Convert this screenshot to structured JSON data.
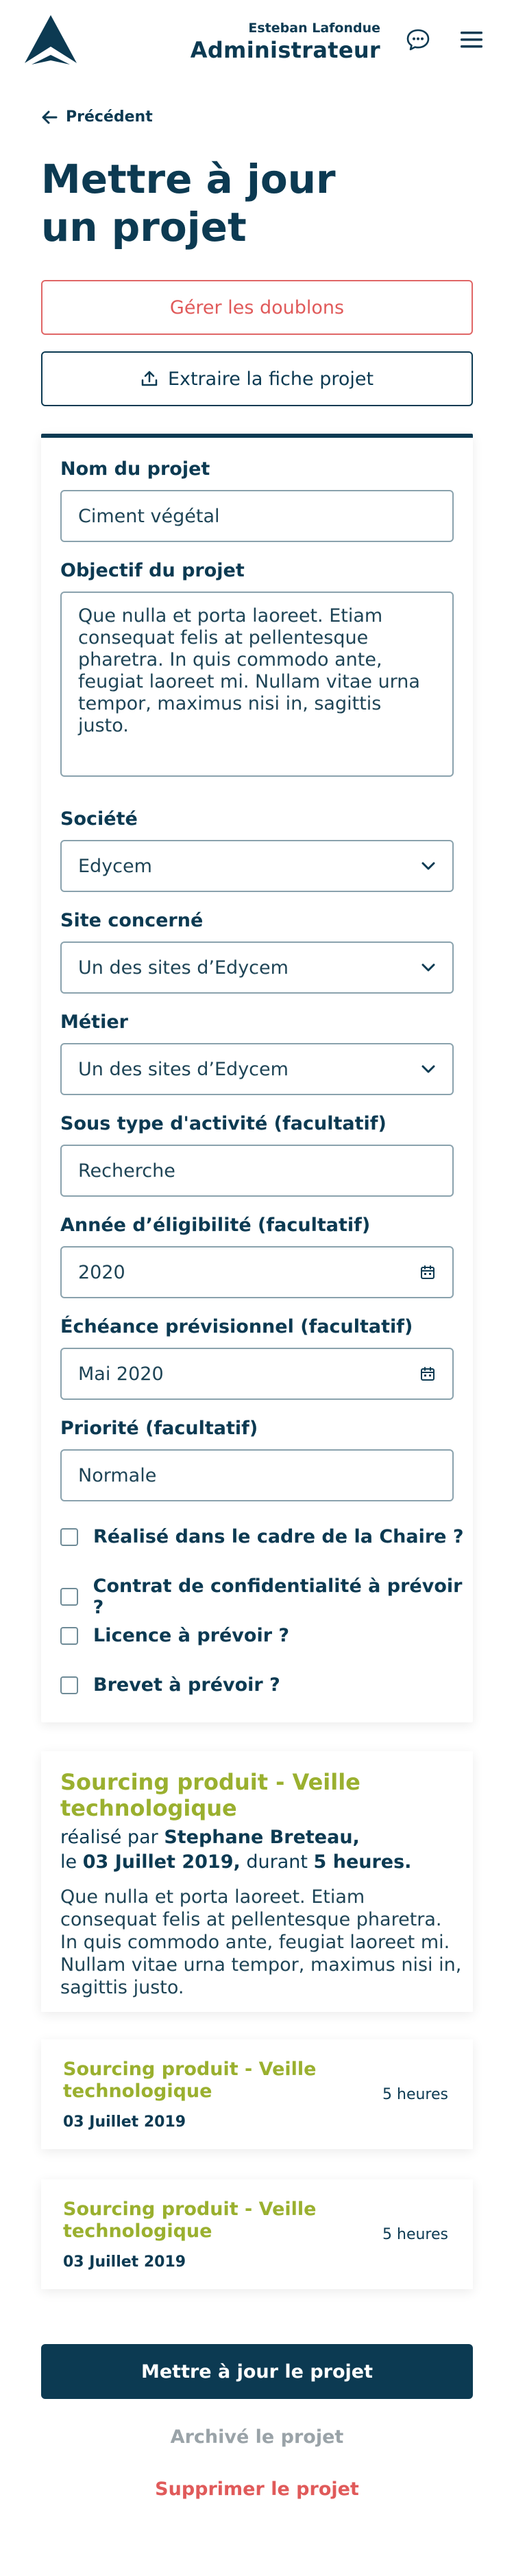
{
  "header": {
    "user_name": "Esteban Lafondue",
    "user_role": "Administrateur",
    "icons": {
      "logo": "brand-logo",
      "chat": "chat-bubble-icon",
      "menu": "hamburger-menu-icon"
    }
  },
  "nav": {
    "back_label": "Précédent"
  },
  "page_title": "Mettre à jour un projet",
  "actions": {
    "duplicates_label": "Gérer les doublons",
    "export_label": "Extraire la fiche projet"
  },
  "form": {
    "project_name": {
      "label": "Nom du projet",
      "value": "Ciment végétal"
    },
    "objective": {
      "label": "Objectif du projet",
      "value": "Que nulla et porta laoreet. Etiam consequat felis at pellentesque pharetra. In quis commodo ante, feugiat laoreet mi. Nullam vitae urna tempor, maximus nisi in, sagittis justo."
    },
    "company": {
      "label": "Société",
      "value": "Edycem"
    },
    "site": {
      "label": "Site concerné",
      "value": "Un des sites d’Edycem"
    },
    "trade": {
      "label": "Métier",
      "value": "Un des sites d’Edycem"
    },
    "subtype": {
      "label": "Sous type d'activité (facultatif)",
      "value": "Recherche"
    },
    "eligibility_year": {
      "label": "Année d’éligibilité (facultatif)",
      "value": "2020"
    },
    "deadline": {
      "label": "Échéance prévisionnel (facultatif)",
      "value": "Mai 2020"
    },
    "priority": {
      "label": "Priorité (facultatif)",
      "value": "Normale"
    },
    "checkboxes": [
      {
        "label": "Réalisé dans le cadre de la Chaire ?",
        "checked": false
      },
      {
        "label": "Contrat de confidentialité à prévoir ?",
        "checked": false
      },
      {
        "label": "Licence à prévoir ?",
        "checked": false
      },
      {
        "label": "Brevet à prévoir ?",
        "checked": false
      }
    ]
  },
  "activity": {
    "title": "Sourcing produit - Veille technologique",
    "by_prefix": "réalisé par",
    "author": "Stephane Breteau,",
    "on_prefix": "le",
    "date": "03 Juillet 2019,",
    "during_prefix": "durant",
    "duration": "5 heures.",
    "description": "Que nulla et porta laoreet. Etiam consequat felis at pellentesque pharetra. In quis commodo ante, feugiat laoreet mi. Nullam vitae urna tempor, maximus nisi in, sagittis justo."
  },
  "activity_list": [
    {
      "title": "Sourcing produit - Veille technologique",
      "date": "03 Juillet 2019",
      "duration": "5 heures"
    },
    {
      "title": "Sourcing produit - Veille technologique",
      "date": "03 Juillet 2019",
      "duration": "5 heures"
    }
  ],
  "footer": {
    "update_label": "Mettre à jour le projet",
    "archive_label": "Archivé le projet",
    "delete_label": "Supprimer le projet"
  },
  "colors": {
    "primary": "#0c3a52",
    "accent_green": "#9ab02f",
    "danger": "#e05a5a",
    "muted": "#9aa3a8"
  }
}
